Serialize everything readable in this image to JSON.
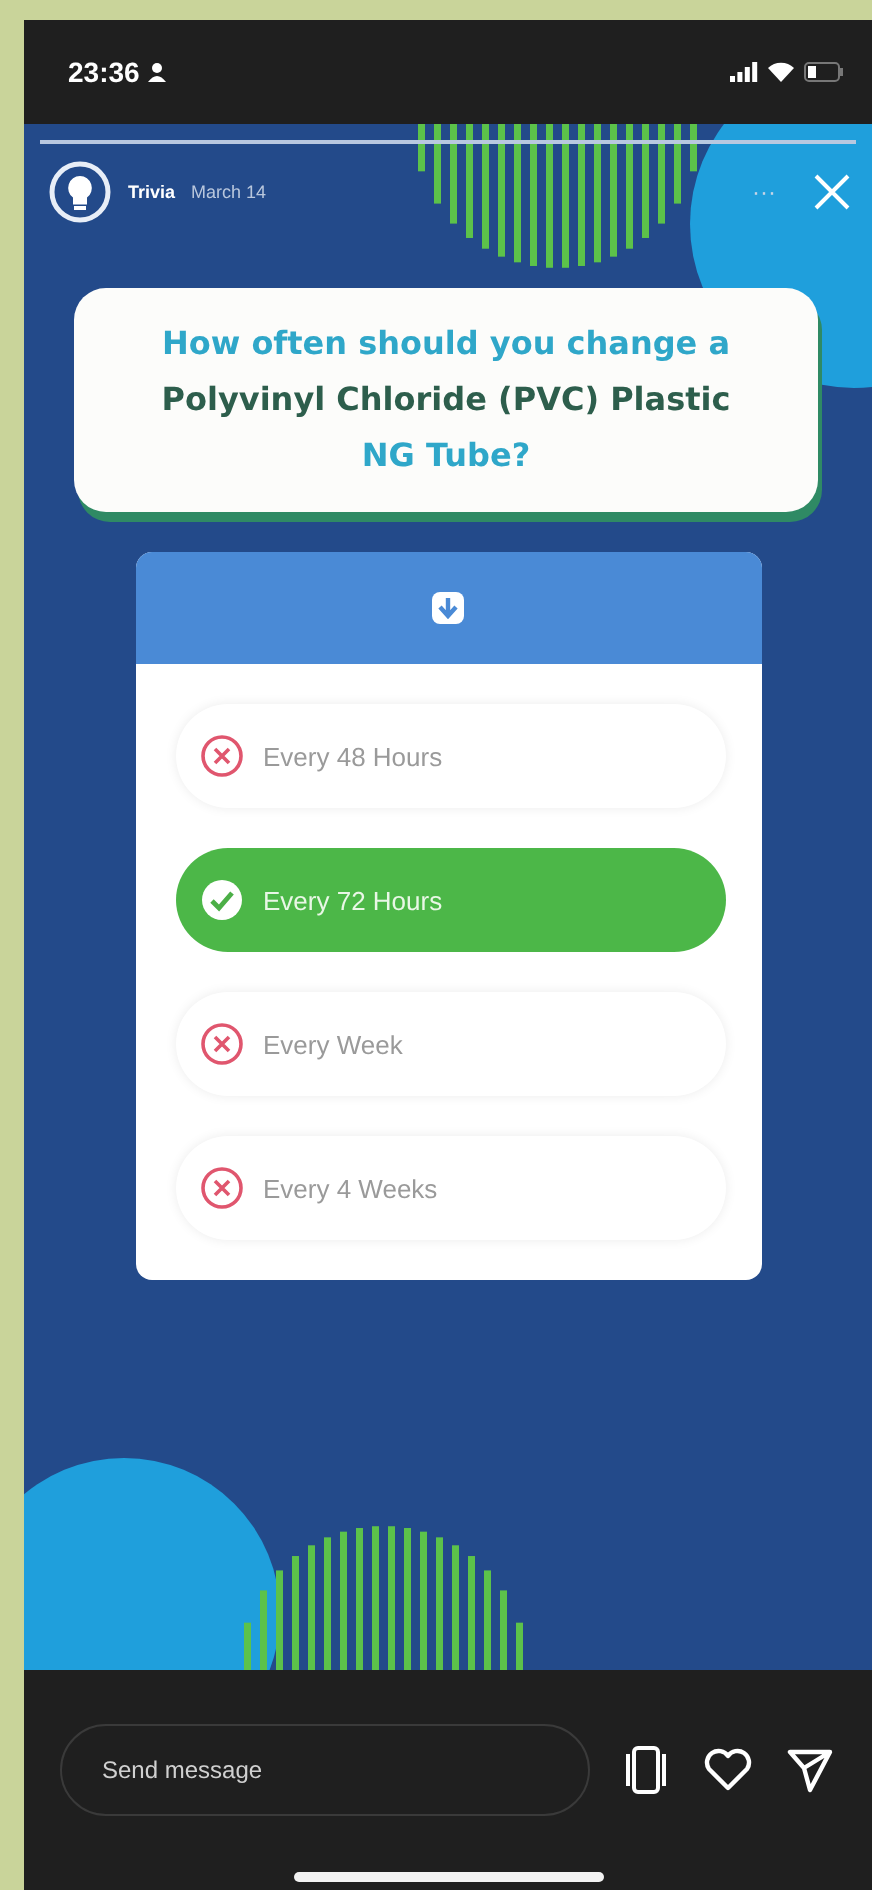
{
  "status_bar": {
    "time": "23:36"
  },
  "story_header": {
    "account": "Trivia",
    "date": "March 14",
    "more": "···"
  },
  "question": [
    {
      "text": "How often should you change a ",
      "color": "#2fa7c9"
    },
    {
      "text": "Polyvinyl Chloride (PVC) Plastic ",
      "color": "#2d5e4c"
    },
    {
      "text": "NG Tube?",
      "color": "#2fa7c9"
    }
  ],
  "options": [
    {
      "text": "Every 48 Hours",
      "selected": false
    },
    {
      "text": "Every 72 Hours",
      "selected": true
    },
    {
      "text": "Every Week",
      "selected": false
    },
    {
      "text": "Every 4 Weeks",
      "selected": false
    }
  ],
  "reply_bar": {
    "placeholder": "Send message"
  }
}
